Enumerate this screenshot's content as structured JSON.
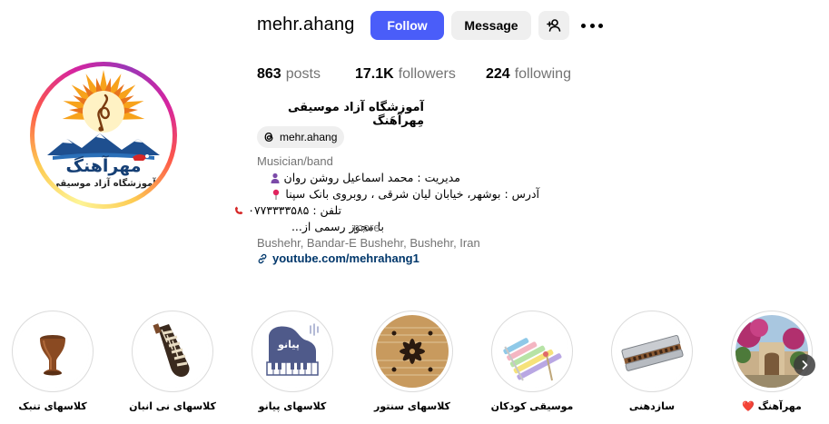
{
  "profile": {
    "username": "mehr.ahang",
    "follow_label": "Follow",
    "message_label": "Message",
    "full_name": "آموزشگاه آزاد موسیقی مِهرآهَنگ",
    "threads_handle": "mehr.ahang",
    "category": "Musician/band",
    "bio_lines": [
      "مدیریت : محمد اسماعیل روشن روان",
      "آدرس : بوشهر، خیابان لیان شرقی ، روبروی بانک سپنا",
      "تلفن : ۰۷۷۳۳۳۳۵۸۵",
      "با مجوز رسمی از..."
    ],
    "more_label": "more",
    "location": "Bushehr, Bandar-E Bushehr, Bushehr, Iran",
    "link": "youtube.com/mehrahang1",
    "avatar_text": {
      "title": "مهرآهنگ",
      "subtitle": "آموزشگاه آزاد موسیقی"
    }
  },
  "stats": {
    "posts_count": "863",
    "posts_label": "posts",
    "followers_count": "17.1K",
    "followers_label": "followers",
    "following_count": "224",
    "following_label": "following"
  },
  "highlights": [
    {
      "label": "کلاسهای تنبک",
      "icon": "tonbak-drum"
    },
    {
      "label": "کلاسهای نی انبان",
      "icon": "neyanban-bagpipe"
    },
    {
      "label": "کلاسهای پیانو",
      "icon": "piano",
      "image_text": "پیانو"
    },
    {
      "label": "کلاسهای سنتور",
      "icon": "santour"
    },
    {
      "label": "موسیقی کودکان",
      "icon": "xylophone"
    },
    {
      "label": "سازدهنی",
      "icon": "harmonica"
    },
    {
      "label": "مهرآهنگ ❤️",
      "icon": "building-flowers"
    }
  ],
  "colors": {
    "follow_button": "#4a5df9",
    "secondary_button": "#efefef",
    "link": "#00376b",
    "muted_text": "#737373",
    "highlight_border": "#dbdbdb"
  }
}
